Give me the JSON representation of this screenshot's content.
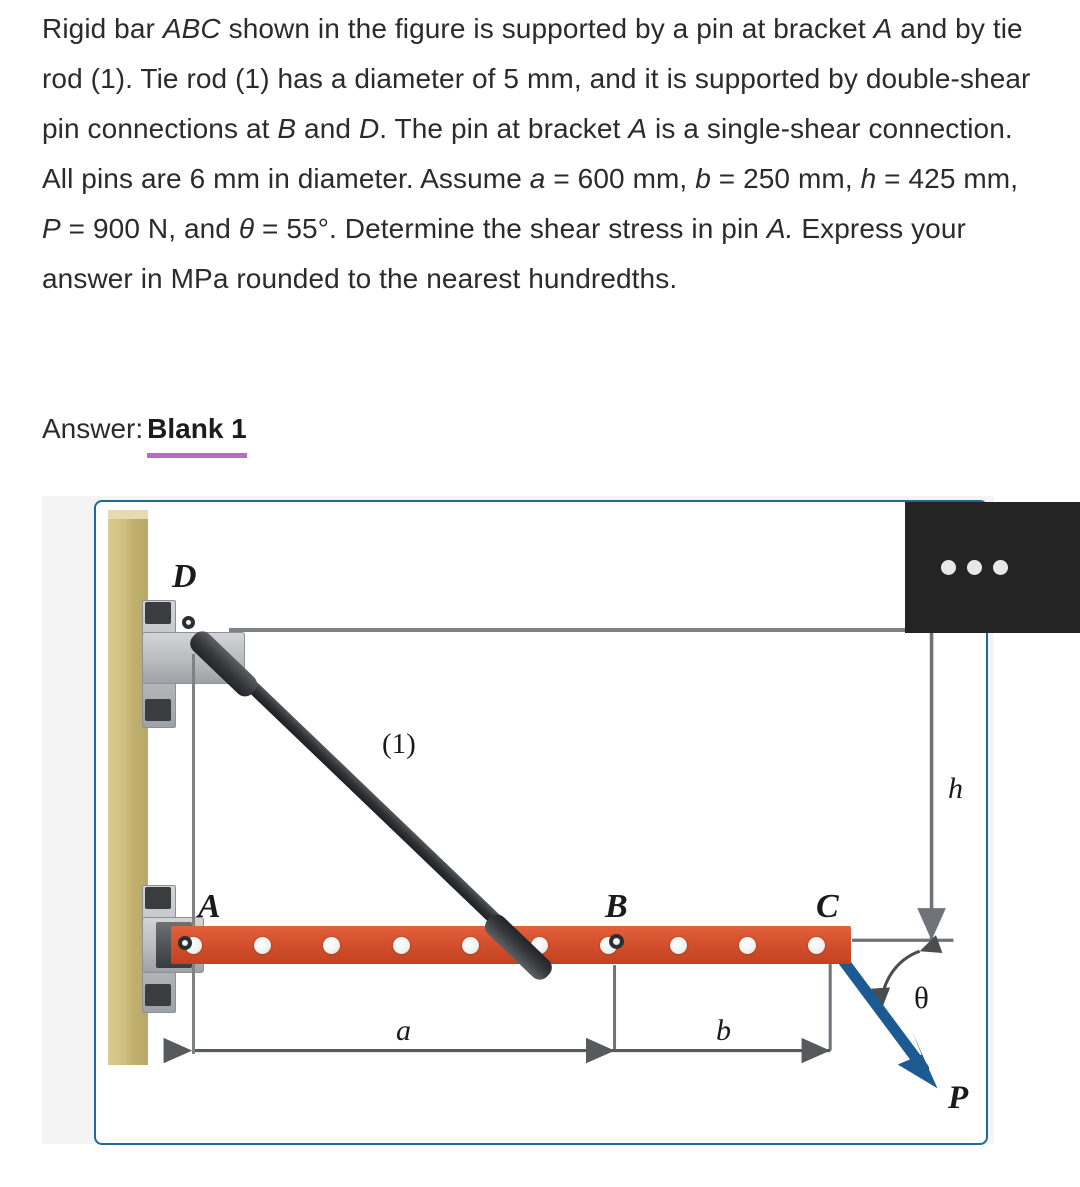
{
  "problem": {
    "segments": [
      {
        "t": "Rigid bar ",
        "i": false
      },
      {
        "t": "ABC",
        "i": true
      },
      {
        "t": " shown in the figure is supported by a pin at bracket ",
        "i": false
      },
      {
        "t": "A",
        "i": true
      },
      {
        "t": " and by tie rod (1). Tie rod (1) has a diameter of 5 mm, and it is supported by double-shear pin connections at ",
        "i": false
      },
      {
        "t": "B",
        "i": true
      },
      {
        "t": " and ",
        "i": false
      },
      {
        "t": "D",
        "i": true
      },
      {
        "t": ". The pin at bracket ",
        "i": false
      },
      {
        "t": "A",
        "i": true
      },
      {
        "t": " is a single-shear connection. All pins are 6 mm in diameter. Assume ",
        "i": false
      },
      {
        "t": "a",
        "i": true
      },
      {
        "t": " = 600 mm, ",
        "i": false
      },
      {
        "t": "b",
        "i": true
      },
      {
        "t": " = 250 mm, ",
        "i": false
      },
      {
        "t": "h",
        "i": true
      },
      {
        "t": " = 425 mm, ",
        "i": false
      },
      {
        "t": "P",
        "i": true
      },
      {
        "t": " = 900 N, and ",
        "i": false
      },
      {
        "t": "θ",
        "i": true
      },
      {
        "t": " = 55°. Determine the shear stress in pin ",
        "i": false
      },
      {
        "t": "A.",
        "i": true
      },
      {
        "t": " Express your answer in MPa rounded to the nearest hundredths.",
        "i": false
      }
    ],
    "plain": "Rigid bar ABC shown in the figure is supported by a pin at bracket A and by tie rod (1). Tie rod (1) has a diameter of 5 mm, and it is supported by double-shear pin connections at B and D. The pin at bracket A is a single-shear connection. All pins are 6 mm in diameter. Assume a = 600 mm, b = 250 mm, h = 425 mm, P = 900 N, and θ = 55°. Determine the shear stress in pin A. Express your answer in MPa rounded to the nearest hundredths.",
    "givens": {
      "tie_rod_diameter": "5 mm",
      "pin_diameter": "6 mm",
      "a": "600 mm",
      "b": "250 mm",
      "h": "425 mm",
      "P": "900 N",
      "theta": "55°",
      "answer_units": "MPa",
      "rounding": "nearest hundredths"
    }
  },
  "answer": {
    "label": "Answer:",
    "blank_label": "Blank 1",
    "underline_color": "#b06fc4"
  },
  "figure": {
    "border_color": "#1d6a93",
    "bar_color": "#d4502e",
    "wall_color": "#cfbf7e",
    "rod_color": "#2f3234",
    "force_arrow_color": "#1d5a92",
    "dimension_color": "#6f7276",
    "labels": {
      "point_A": "A",
      "point_B": "B",
      "point_C": "C",
      "point_D": "D",
      "rod": "(1)",
      "dim_a": "a",
      "dim_b": "b",
      "dim_h": "h",
      "angle": "θ",
      "force": "P"
    },
    "bar_hole_count": 10
  },
  "overlay_menu": {
    "name": "more-options",
    "dots": 3,
    "background": "#242424"
  }
}
